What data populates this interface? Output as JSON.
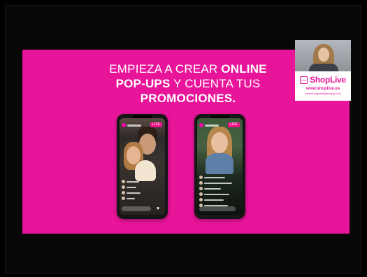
{
  "slide": {
    "line1_regular": "EMPIEZA A CREAR ",
    "line1_bold": "ONLINE",
    "line2_bold": "POP-UPS",
    "line2_regular": " Y CUENTA TUS",
    "line3_bold": "PROMOCIONES."
  },
  "brand": {
    "icon_text": "Live",
    "name": "ShopLive",
    "url": "www.shoplive.es",
    "email": "carolina.argente@gyopopup.com"
  },
  "phone1": {
    "live_label": "LIVE"
  },
  "phone2": {
    "live_label": "LIVE"
  },
  "colors": {
    "slide_bg": "#e8159a",
    "frame_bg": "#000000",
    "accent": "#e8159a"
  }
}
